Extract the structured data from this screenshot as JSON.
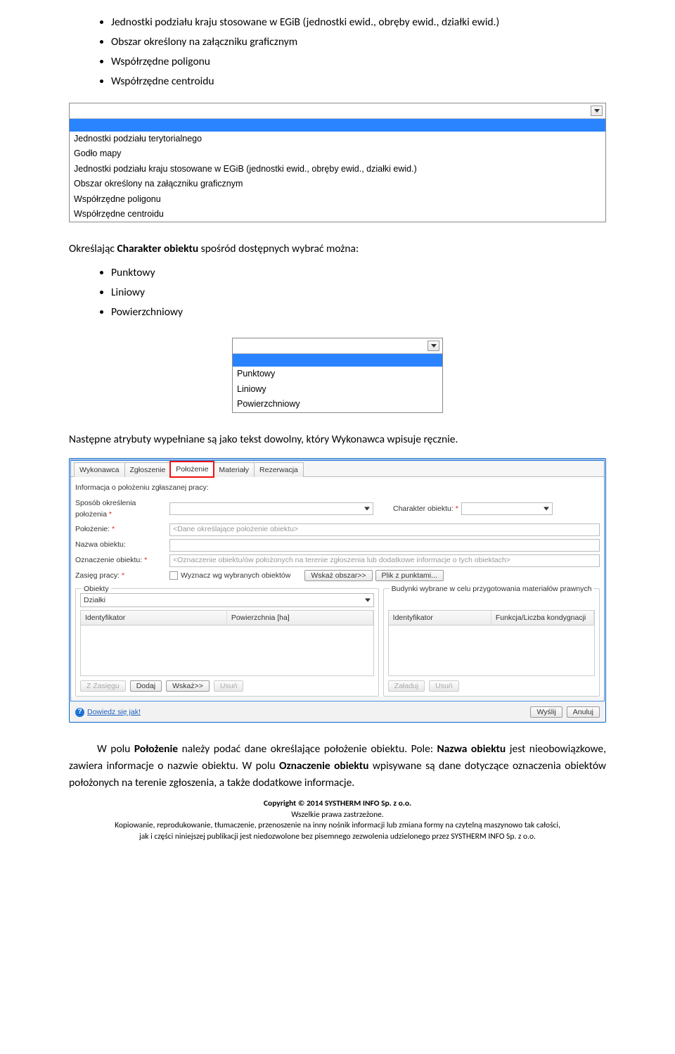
{
  "bullets_top": {
    "b1": "Jednostki podziału kraju stosowane w EGiB (jednostki ewid., obręby ewid., działki ewid.)",
    "b2": "Obszar określony na załączniku graficznym",
    "b3": "Współrzędne poligonu",
    "b4": "Współrzędne centroidu"
  },
  "dropdown1": {
    "o1": "Jednostki podziału terytorialnego",
    "o2": "Godło mapy",
    "o3": "Jednostki podziału kraju stosowane w EGiB (jednostki ewid., obręby ewid., działki ewid.)",
    "o4": "Obszar określony na załączniku graficznym",
    "o5": "Współrzędne poligonu",
    "o6": "Współrzędne centroidu"
  },
  "para1_pre": "Określając ",
  "para1_strong": "Charakter obiektu",
  "para1_post": " spośród dostępnych wybrać można:",
  "bullets_mid": {
    "b1": "Punktowy",
    "b2": "Liniowy",
    "b3": "Powierzchniowy"
  },
  "dropdown2": {
    "o1": "Punktowy",
    "o2": "Liniowy",
    "o3": "Powierzchniowy"
  },
  "para2": "Następne atrybuty wypełniane są jako tekst dowolny, który Wykonawca wpisuje ręcznie.",
  "form": {
    "tabs": {
      "t1": "Wykonawca",
      "t2": "Zgłoszenie",
      "t3": "Położenie",
      "t4": "Materiały",
      "t5": "Rezerwacja"
    },
    "info": "Informacja o położeniu zgłaszanej pracy:",
    "labels": {
      "sposob": "Sposób określenia położenia",
      "charakter": "Charakter obiektu:",
      "polozenie": "Położenie:",
      "nazwa": "Nazwa obiektu:",
      "oznaczenie": "Oznaczenie obiektu:",
      "zasieg": "Zasięg pracy:"
    },
    "placeholders": {
      "polozenie": "<Dane określające położenie obiektu>",
      "oznaczenie": "<Oznaczenie obiektu/ów położonych na terenie zgłoszenia lub dodatkowe informacje o tych obiektach>"
    },
    "zasieg_chk": "Wyznacz wg wybranych obiektów",
    "buttons": {
      "wskaz_obszar": "Wskaż obszar>>",
      "plik": "Plik z punktami...",
      "zzasiegu": "Z Zasięgu",
      "dodaj": "Dodaj",
      "wskaz": "Wskaż>>",
      "usun": "Usuń",
      "zaladuj": "Załaduj",
      "usun2": "Usuń",
      "wyslij": "Wyślij",
      "anuluj": "Anuluj"
    },
    "groups": {
      "obiekty": "Obiekty",
      "budynki": "Budynki wybrane w celu przygotowania materiałów prawnych"
    },
    "tables": {
      "dzialki": "Działki",
      "ident": "Identyfikator",
      "powierzchnia": "Powierzchnia [ha]",
      "funkcja": "Funkcja/Liczba kondygnacji"
    },
    "help": "Dowiedz się jak!",
    "star": "*"
  },
  "para3": {
    "t1": "W polu ",
    "s1": "Położenie",
    "t2": " należy podać dane określające położenie obiektu. Pole: ",
    "s2": "Nazwa obiektu",
    "t3": " jest nieobowiązkowe, zawiera informacje o nazwie obiektu. W polu ",
    "s3": "Oznaczenie obiektu",
    "t4": " wpisywane są dane dotyczące oznaczenia obiektów położonych na terenie zgłoszenia, a także dodatkowe informacje."
  },
  "footer": {
    "l1": "Copyright © 2014 SYSTHERM INFO Sp. z o.o.",
    "l2": "Wszelkie prawa zastrzeżone.",
    "l3": "Kopiowanie, reprodukowanie, tłumaczenie, przenoszenie na inny nośnik informacji lub zmiana formy na czytelną maszynowo tak całości,",
    "l4": "jak i części niniejszej publikacji jest niedozwolone bez pisemnego zezwolenia udzielonego przez SYSTHERM INFO Sp. z o.o."
  }
}
